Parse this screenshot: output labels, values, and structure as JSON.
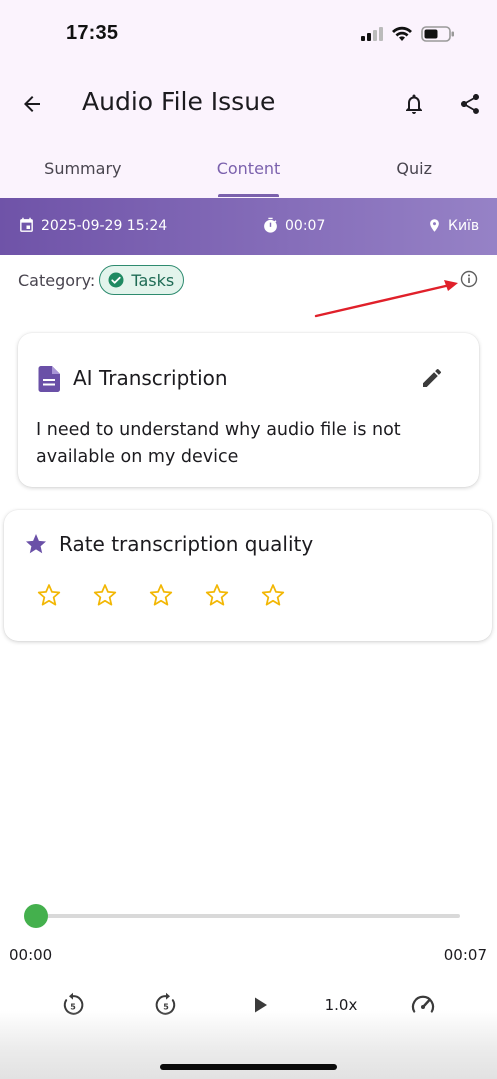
{
  "status_bar": {
    "time": "17:35",
    "icons": [
      "cellular-signal-icon",
      "wifi-icon",
      "battery-icon"
    ]
  },
  "appbar": {
    "title": "Audio File Issue",
    "icons": [
      "back-arrow-icon",
      "bell-icon",
      "share-icon"
    ]
  },
  "tabs": [
    {
      "label": "Summary",
      "active": false
    },
    {
      "label": "Content",
      "active": true
    },
    {
      "label": "Quiz",
      "active": false
    }
  ],
  "banner": {
    "datetime": "2025-09-29 15:24",
    "duration": "00:07",
    "location": "Київ"
  },
  "category": {
    "label": "Category:",
    "value": "Tasks"
  },
  "transcription": {
    "title": "AI Transcription",
    "text": "I need to understand why audio file is not available on my device"
  },
  "rating": {
    "title": "Rate transcription quality",
    "max_stars": 5,
    "value": 0
  },
  "player": {
    "current_time": "00:00",
    "total_time": "00:07",
    "progress": 0,
    "speed": "1.0x"
  },
  "colors": {
    "accent": "#7b61ad",
    "banner_start": "#6f53a8",
    "banner_end": "#9682c6",
    "chip_green": "#2e8b6f",
    "player_green": "#44b04d",
    "star_yellow": "#f2b705",
    "annotation_red": "#e0202a",
    "top_background": "#fbf3fd"
  }
}
